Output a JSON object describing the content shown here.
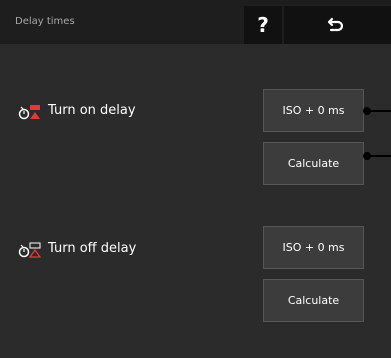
{
  "header": {
    "title": "Delay times",
    "help_label": "?",
    "back_icon": "return-arrow-icon"
  },
  "turn_on": {
    "label": "Turn on delay",
    "icon": "turn-on-delay-icon",
    "value_button": "ISO + 0 ms",
    "calculate_button": "Calculate"
  },
  "turn_off": {
    "label": "Turn off delay",
    "icon": "turn-off-delay-icon",
    "value_button": "ISO + 0 ms",
    "calculate_button": "Calculate"
  },
  "colors": {
    "accent_red": "#e53935",
    "background": "#2b2b2b",
    "header": "#1e1e1e"
  }
}
